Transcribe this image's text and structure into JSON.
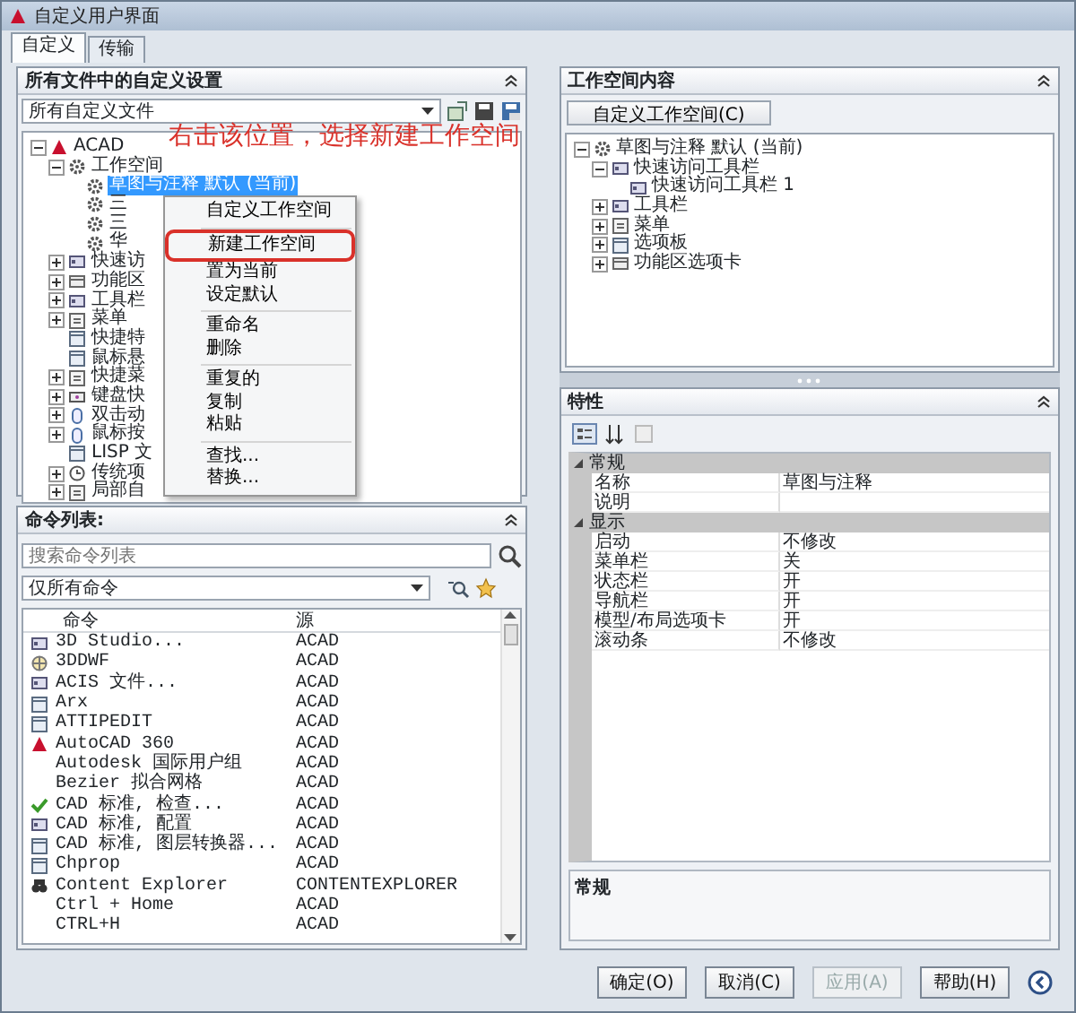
{
  "window": {
    "title": "自定义用户界面"
  },
  "tabs": [
    {
      "label": "自定义",
      "selected": true
    },
    {
      "label": "传输",
      "selected": false
    }
  ],
  "customizations_panel": {
    "title": "所有文件中的自定义设置",
    "file_dropdown": "所有自定义文件",
    "tree": [
      {
        "label": "ACAD",
        "kind": "logo",
        "expanded": true,
        "selected": false,
        "children": [
          {
            "label": "工作空间",
            "kind": "gear",
            "expanded": true,
            "selected": false,
            "children": [
              {
                "label": "草图与注释 默认 (当前)",
                "kind": "gear",
                "selected": true
              },
              {
                "label": "三",
                "kind": "gear",
                "selected": false
              },
              {
                "label": "三",
                "kind": "gear",
                "selected": false
              },
              {
                "label": "华",
                "kind": "gear",
                "selected": false
              }
            ]
          },
          {
            "label": "快速访",
            "kind": "toolbar",
            "expanded": false,
            "selected": false
          },
          {
            "label": "功能区",
            "kind": "ribbon",
            "expanded": false,
            "selected": false
          },
          {
            "label": "工具栏",
            "kind": "toolbar",
            "expanded": false,
            "selected": false
          },
          {
            "label": "菜单",
            "kind": "menu",
            "expanded": false,
            "selected": false
          },
          {
            "label": "快捷特",
            "kind": "panel",
            "selected": false
          },
          {
            "label": "鼠标悬",
            "kind": "panel",
            "selected": false
          },
          {
            "label": "快捷菜",
            "kind": "menu",
            "expanded": false,
            "selected": false
          },
          {
            "label": "键盘快",
            "kind": "keyboard",
            "expanded": false,
            "selected": false
          },
          {
            "label": "双击动",
            "kind": "mouse",
            "expanded": false,
            "selected": false
          },
          {
            "label": "鼠标按",
            "kind": "mouse",
            "expanded": false,
            "selected": false
          },
          {
            "label": "LISP 文",
            "kind": "panel",
            "selected": false
          },
          {
            "label": "传统项",
            "kind": "clock",
            "expanded": false,
            "selected": false
          },
          {
            "label": "局部自",
            "kind": "menu",
            "expanded": false,
            "selected": false
          }
        ]
      }
    ]
  },
  "annotation": {
    "text": "右击该位置，选择新建工作空间"
  },
  "context_menu": {
    "items": [
      {
        "kind": "item",
        "label": "自定义工作空间",
        "outlined": false
      },
      {
        "kind": "separator"
      },
      {
        "kind": "item",
        "label": "新建工作空间",
        "outlined": true
      },
      {
        "kind": "item",
        "label": "置为当前",
        "outlined": false
      },
      {
        "kind": "item",
        "label": "设定默认",
        "outlined": false
      },
      {
        "kind": "separator"
      },
      {
        "kind": "item",
        "label": "重命名",
        "outlined": false
      },
      {
        "kind": "item",
        "label": "删除",
        "outlined": false
      },
      {
        "kind": "separator"
      },
      {
        "kind": "item",
        "label": "重复的",
        "outlined": false
      },
      {
        "kind": "item",
        "label": "复制",
        "outlined": false
      },
      {
        "kind": "item",
        "label": "粘贴",
        "outlined": false
      },
      {
        "kind": "separator"
      },
      {
        "kind": "item",
        "label": "查找...",
        "outlined": false
      },
      {
        "kind": "item",
        "label": "替换...",
        "outlined": false
      }
    ]
  },
  "command_list": {
    "title": "命令列表:",
    "search": {
      "placeholder": "搜索命令列表"
    },
    "filter_dropdown": "仅所有命令",
    "columns": [
      "命令",
      "源"
    ],
    "rows": [
      {
        "kind": "toolbar",
        "command": "3D Studio...",
        "source": "ACAD"
      },
      {
        "kind": "globe",
        "command": "3DDWF",
        "source": "ACAD"
      },
      {
        "kind": "toolbar",
        "command": "ACIS 文件...",
        "source": "ACAD"
      },
      {
        "kind": "panel",
        "command": "Arx",
        "source": "ACAD"
      },
      {
        "kind": "panel",
        "command": "ATTIPEDIT",
        "source": "ACAD"
      },
      {
        "kind": "logo",
        "command": "AutoCAD 360",
        "source": "ACAD"
      },
      {
        "kind": "none",
        "command": "Autodesk 国际用户组",
        "source": "ACAD"
      },
      {
        "kind": "none",
        "command": "Bezier 拟合网格",
        "source": "ACAD"
      },
      {
        "kind": "check",
        "command": "CAD 标准, 检查...",
        "source": "ACAD"
      },
      {
        "kind": "toolbar",
        "command": "CAD 标准, 配置",
        "source": "ACAD"
      },
      {
        "kind": "panel",
        "command": "CAD 标准, 图层转换器...",
        "source": "ACAD"
      },
      {
        "kind": "panel",
        "command": "Chprop",
        "source": "ACAD"
      },
      {
        "kind": "binoculars",
        "command": "Content Explorer",
        "source": "CONTENTEXPLORER"
      },
      {
        "kind": "none",
        "command": "Ctrl + Home",
        "source": "ACAD"
      },
      {
        "kind": "none",
        "command": "CTRL+H",
        "source": "ACAD"
      }
    ]
  },
  "workspace_contents": {
    "title": "工作空间内容",
    "button": "自定义工作空间(C)",
    "tree": [
      {
        "label": "草图与注释 默认 (当前)",
        "kind": "gear",
        "expanded": true,
        "children": [
          {
            "label": "快速访问工具栏",
            "kind": "toolbar",
            "expanded": true,
            "children": [
              {
                "label": "快速访问工具栏 1",
                "kind": "toolbar"
              }
            ]
          },
          {
            "label": "工具栏",
            "kind": "toolbar",
            "expanded": false
          },
          {
            "label": "菜单",
            "kind": "menu",
            "expanded": false
          },
          {
            "label": "选项板",
            "kind": "panel",
            "expanded": false
          },
          {
            "label": "功能区选项卡",
            "kind": "ribbon",
            "expanded": false
          }
        ]
      }
    ]
  },
  "properties": {
    "title": "特性",
    "groups": [
      {
        "name": "常规",
        "expanded": true,
        "rows": [
          {
            "name": "名称",
            "value": "草图与注释"
          },
          {
            "name": "说明"
          }
        ]
      },
      {
        "name": "显示",
        "expanded": true,
        "rows": [
          {
            "name": "启动",
            "value": "不修改"
          },
          {
            "name": "菜单栏",
            "value": "关"
          },
          {
            "name": "状态栏",
            "value": "开"
          },
          {
            "name": "导航栏",
            "value": "开"
          },
          {
            "name": "模型/布局选项卡",
            "value": "开"
          },
          {
            "name": "滚动条",
            "value": "不修改"
          }
        ]
      }
    ],
    "description": "常规"
  },
  "buttons": [
    {
      "label": "确定(O)",
      "disabled": false
    },
    {
      "label": "取消(C)",
      "disabled": false
    },
    {
      "label": "应用(A)",
      "disabled": true
    },
    {
      "label": "帮助(H)",
      "disabled": false
    }
  ]
}
